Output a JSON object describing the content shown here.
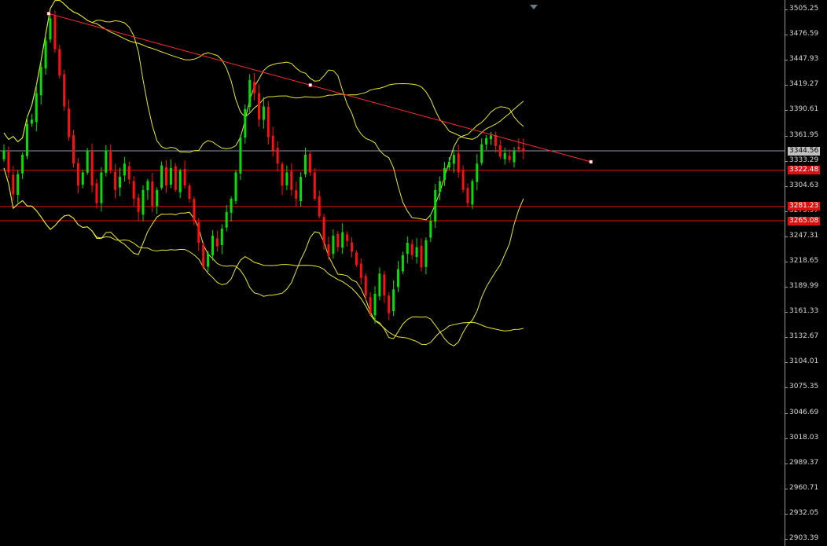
{
  "chart_data": {
    "type": "candlestick",
    "title": "",
    "xlabel": "",
    "ylabel": "",
    "ylim": [
      2895.0,
      3510.0
    ],
    "y_tick_labels": [
      "3505.25",
      "3476.59",
      "3447.93",
      "3419.27",
      "3390.61",
      "3361.95",
      "3333.29",
      "3304.63",
      "3275.97",
      "3247.31",
      "3218.65",
      "3189.99",
      "3161.33",
      "3132.67",
      "3104.01",
      "3075.35",
      "3046.69",
      "3018.03",
      "2989.37",
      "2960.71",
      "2932.05",
      "2903.39"
    ],
    "current_price": "3344.56",
    "horizontal_levels": [
      {
        "label": "3322.48",
        "value": 3322.48
      },
      {
        "label": "3281.23",
        "value": 3281.23
      },
      {
        "label": "3265.08",
        "value": 3265.08
      }
    ],
    "trendline": {
      "start_bar": 0,
      "start_value": 3500.5,
      "end_bar": 114,
      "end_value": 3332.0,
      "anchors": [
        0,
        55,
        114
      ]
    },
    "bollinger_period": 20,
    "bollinger_period_long": 40,
    "colors": {
      "bull": "#00e000",
      "bear": "#ff1010",
      "bands": "#e8e832",
      "trendline": "#ff3030",
      "level": "#e81010",
      "current": "#8a96a2"
    },
    "closes": [
      3345,
      3320,
      3295,
      3318,
      3340,
      3375,
      3380,
      3410,
      3440,
      3470,
      3495,
      3460,
      3430,
      3395,
      3360,
      3330,
      3305,
      3320,
      3345,
      3305,
      3285,
      3320,
      3345,
      3322,
      3300,
      3315,
      3330,
      3312,
      3290,
      3275,
      3300,
      3310,
      3282,
      3300,
      3328,
      3305,
      3325,
      3300,
      3322,
      3305,
      3290,
      3265,
      3240,
      3212,
      3228,
      3248,
      3236,
      3256,
      3275,
      3290,
      3320,
      3360,
      3392,
      3425,
      3410,
      3380,
      3395,
      3360,
      3345,
      3330,
      3305,
      3320,
      3300,
      3290,
      3315,
      3340,
      3320,
      3290,
      3270,
      3240,
      3225,
      3248,
      3235,
      3252,
      3242,
      3230,
      3215,
      3200,
      3180,
      3160,
      3182,
      3205,
      3180,
      3160,
      3187,
      3210,
      3226,
      3240,
      3226,
      3235,
      3212,
      3243,
      3265,
      3300,
      3310,
      3325,
      3332,
      3340,
      3320,
      3300,
      3285,
      3310,
      3330,
      3352,
      3359,
      3362,
      3350,
      3338,
      3342,
      3334,
      3344,
      3346,
      3344.56
    ]
  }
}
